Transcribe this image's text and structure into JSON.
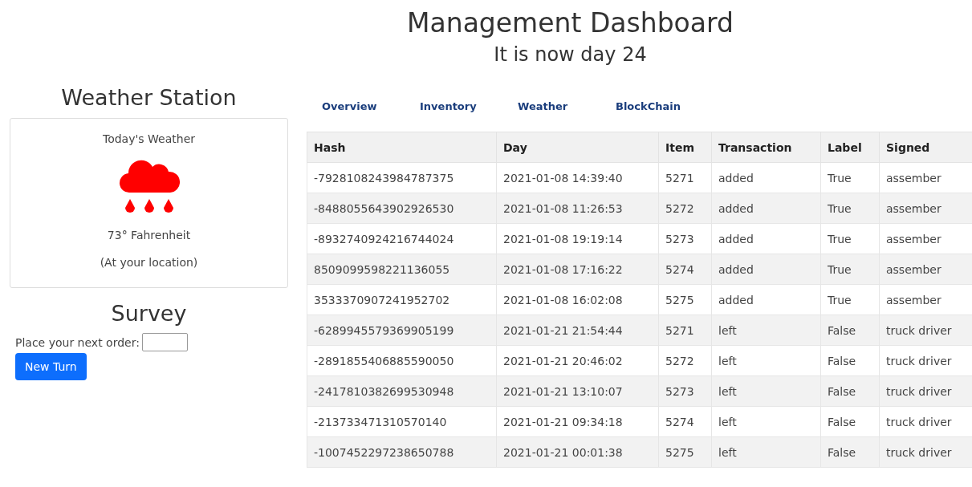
{
  "header": {
    "title": "Management Dashboard",
    "subtitle": "It is now day 24"
  },
  "weather_station": {
    "title": "Weather Station",
    "card_title": "Today's Weather",
    "temperature": "73° Fahrenheit",
    "location": "(At your location)"
  },
  "survey": {
    "title": "Survey",
    "order_label": "Place your next order:",
    "button": "New Turn"
  },
  "tabs": [
    "Overview",
    "Inventory",
    "Weather",
    "BlockChain"
  ],
  "table": {
    "columns": [
      "Hash",
      "Day",
      "Item",
      "Transaction",
      "Label",
      "Signed"
    ],
    "rows": [
      [
        "-7928108243984787375",
        "2021-01-08 14:39:40",
        "5271",
        "added",
        "True",
        "assember"
      ],
      [
        "-8488055643902926530",
        "2021-01-08 11:26:53",
        "5272",
        "added",
        "True",
        "assember"
      ],
      [
        "-8932740924216744024",
        "2021-01-08 19:19:14",
        "5273",
        "added",
        "True",
        "assember"
      ],
      [
        "8509099598221136055",
        "2021-01-08 17:16:22",
        "5274",
        "added",
        "True",
        "assember"
      ],
      [
        "3533370907241952702",
        "2021-01-08 16:02:08",
        "5275",
        "added",
        "True",
        "assember"
      ],
      [
        "-6289945579369905199",
        "2021-01-21 21:54:44",
        "5271",
        "left",
        "False",
        "truck driver"
      ],
      [
        "-2891855406885590050",
        "2021-01-21 20:46:02",
        "5272",
        "left",
        "False",
        "truck driver"
      ],
      [
        "-2417810382699530948",
        "2021-01-21 13:10:07",
        "5273",
        "left",
        "False",
        "truck driver"
      ],
      [
        "-213733471310570140",
        "2021-01-21 09:34:18",
        "5274",
        "left",
        "False",
        "truck driver"
      ],
      [
        "-1007452297238650788",
        "2021-01-21 00:01:38",
        "5275",
        "left",
        "False",
        "truck driver"
      ]
    ]
  }
}
